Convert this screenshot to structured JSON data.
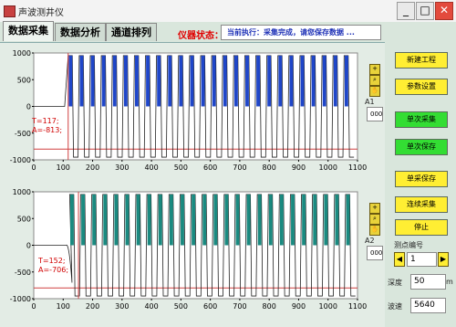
{
  "window": {
    "title": "声波测井仪",
    "minimize": "_",
    "maximize": "□",
    "close": "✕"
  },
  "tabs": [
    "数据采集",
    "数据分析",
    "通道排列"
  ],
  "status": {
    "label": "仪器状态：",
    "message": "当前执行：采集完成，请您保存数据 ..."
  },
  "charts": {
    "y_ticks": [
      "1000",
      "500",
      "0",
      "-500",
      "-1000"
    ],
    "x_ticks": [
      "0",
      "100",
      "200",
      "300",
      "400",
      "500",
      "600",
      "700",
      "800",
      "900",
      "1000",
      "1100"
    ],
    "chart1": {
      "channel": "A1",
      "field": "000",
      "cursor_t": "T=117;",
      "cursor_a": "A=-813;",
      "fill_color": "#1f46c9"
    },
    "chart2": {
      "channel": "A2",
      "field": "000",
      "cursor_t": "T=152;",
      "cursor_a": "A=-706;",
      "fill_color": "#1a8a80"
    }
  },
  "chart_data": [
    {
      "type": "line",
      "name": "A1",
      "x_range": [
        0,
        1100
      ],
      "y_range": [
        -1000,
        1000
      ],
      "cursor": {
        "t": 117,
        "a": -813
      },
      "threshold_y": -800
    },
    {
      "type": "line",
      "name": "A2",
      "x_range": [
        0,
        1100
      ],
      "y_range": [
        -1000,
        1000
      ],
      "cursor": {
        "t": 152,
        "a": -706
      },
      "threshold_y": -800
    }
  ],
  "controls": {
    "new_project": "新建工程",
    "param_settings": "参数设置",
    "single_acquire": "单次采集",
    "single_save": "单次保存",
    "single_acquire_save": "单采保存",
    "continuous_acquire": "连续采集",
    "stop": "停止",
    "measure_point_label": "测点编号",
    "measure_point_value": "1",
    "depth_label": "深度",
    "depth_value": "50",
    "depth_unit": "m",
    "speed_label": "波速",
    "speed_value": "5640"
  },
  "colors": {
    "window_bg": "#d9e6dc",
    "status_red": "#e00000",
    "status_blue": "#1c2fb6",
    "button_yellow": "#ffee33",
    "button_green": "#33dd33"
  }
}
